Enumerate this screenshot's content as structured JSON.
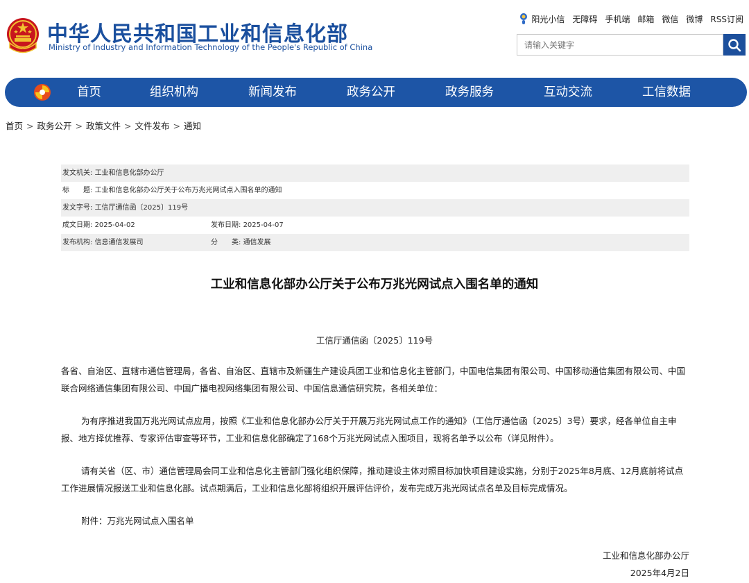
{
  "header": {
    "site_title": "中华人民共和国工业和信息化部",
    "site_subtitle": "Ministry of Industry and Information Technology of the People's Republic of China",
    "emblem_icon": "national-emblem-icon",
    "top_links": [
      "阳光小信",
      "无障碍",
      "手机端",
      "邮箱",
      "微信",
      "微博",
      "RSS订阅"
    ],
    "search": {
      "placeholder": "请输入关键字",
      "icon": "search-icon"
    },
    "colors": {
      "brand_blue": "#1a4f9e",
      "nav_blue": "#1d55a6"
    }
  },
  "nav": {
    "logo_icon": "miit-logo-icon",
    "items": [
      "首页",
      "组织机构",
      "新闻发布",
      "政务公开",
      "政务服务",
      "互动交流",
      "工信数据"
    ]
  },
  "breadcrumb": {
    "items": [
      "首页",
      "政务公开",
      "政策文件",
      "文件发布",
      "通知"
    ],
    "separator": ">"
  },
  "meta": {
    "issuer_label": "发文机关:",
    "issuer": "工业和信息化部办公厅",
    "title_label": "标　　题:",
    "title": "工业和信息化部办公厅关于公布万兆光网试点入围名单的通知",
    "doc_no_label": "发文字号:",
    "doc_no": "工信厅通信函〔2025〕119号",
    "created_label": "成文日期:",
    "created": "2025-04-02",
    "published_label": "发布日期:",
    "published": "2025-04-07",
    "org_label": "发布机构:",
    "org": "信息通信发展司",
    "category_label": "分　　类:",
    "category": "通信发展"
  },
  "article": {
    "title": "工业和信息化部办公厅关于公布万兆光网试点入围名单的通知",
    "doc_number": "工信厅通信函〔2025〕119号",
    "paragraphs": [
      "各省、自治区、直辖市通信管理局，各省、自治区、直辖市及新疆生产建设兵团工业和信息化主管部门，中国电信集团有限公司、中国移动通信集团有限公司、中国联合网络通信集团有限公司、中国广播电视网络集团有限公司、中国信息通信研究院，各相关单位：",
      "为有序推进我国万兆光网试点应用，按照《工业和信息化部办公厅关于开展万兆光网试点工作的通知》（工信厅通信函〔2025〕3号）要求，经各单位自主申报、地方择优推荐、专家评估审查等环节，工业和信息化部确定了168个万兆光网试点入围项目，现将名单予以公布（详见附件）。",
      "请有关省（区、市）通信管理局会同工业和信息化主管部门强化组织保障，推动建设主体对照目标加快项目建设实施，分别于2025年8月底、12月底前将试点工作进展情况报送工业和信息化部。试点期满后，工业和信息化部将组织开展评估评价，发布完成万兆光网试点名单及目标完成情况。",
      "附件：万兆光网试点入围名单"
    ],
    "signature_org": "工业和信息化部办公厅",
    "signature_date": "2025年4月2日"
  }
}
